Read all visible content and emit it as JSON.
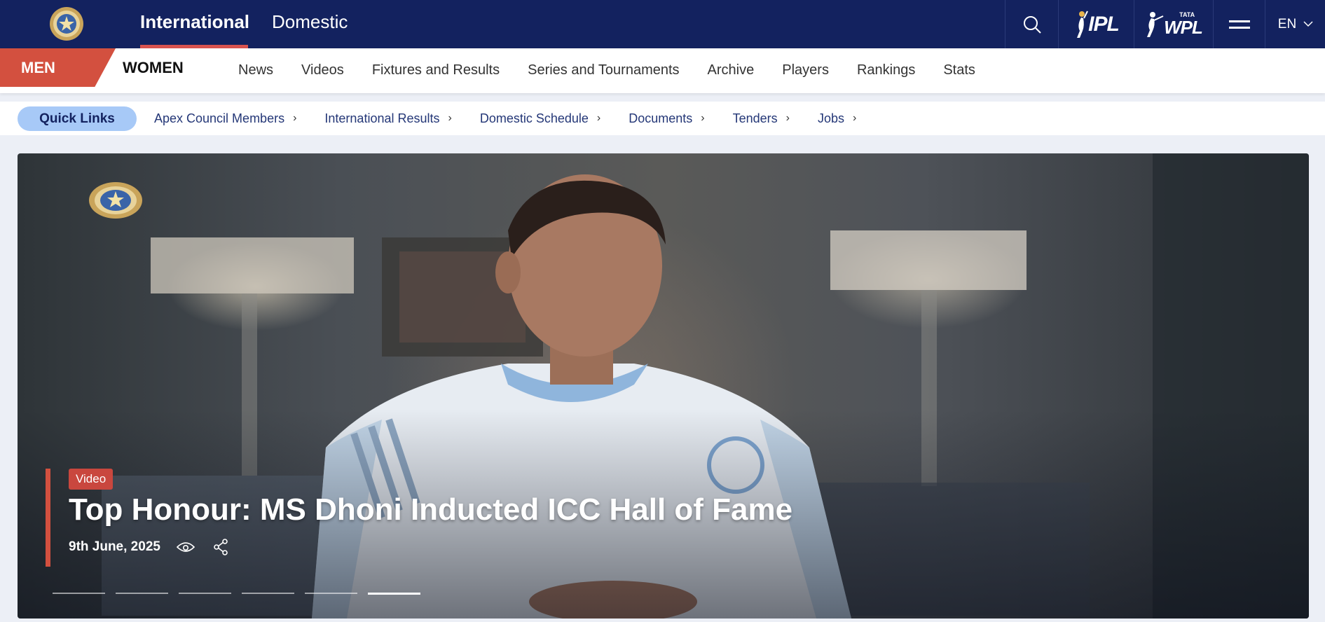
{
  "top_tabs": [
    {
      "label": "International",
      "active": true
    },
    {
      "label": "Domestic",
      "active": false
    }
  ],
  "top_right": {
    "search_icon": "search-icon",
    "ipl_label": "IPL",
    "wpl_label": "WPL",
    "wpl_sponsor": "TATA",
    "menu_icon": "hamburger-menu-icon",
    "language": "EN"
  },
  "gender_tabs": {
    "men": "MEN",
    "women": "WOMEN"
  },
  "nav_items": [
    "News",
    "Videos",
    "Fixtures and Results",
    "Series and Tournaments",
    "Archive",
    "Players",
    "Rankings",
    "Stats"
  ],
  "quick_links": {
    "title": "Quick Links",
    "links": [
      "Apex Council Members",
      "International Results",
      "Domestic Schedule",
      "Documents",
      "Tenders",
      "Jobs"
    ]
  },
  "hero": {
    "badge": "Video",
    "title": "Top Honour: MS Dhoni Inducted ICC Hall of Fame",
    "date": "9th June, 2025",
    "views_icon": "eye-icon",
    "share_icon": "share-icon",
    "slides_total": 6,
    "active_slide": 6
  },
  "colors": {
    "brand_navy": "#13225f",
    "accent_red": "#d3503f",
    "quick_links_pill": "#a7c9f7"
  }
}
